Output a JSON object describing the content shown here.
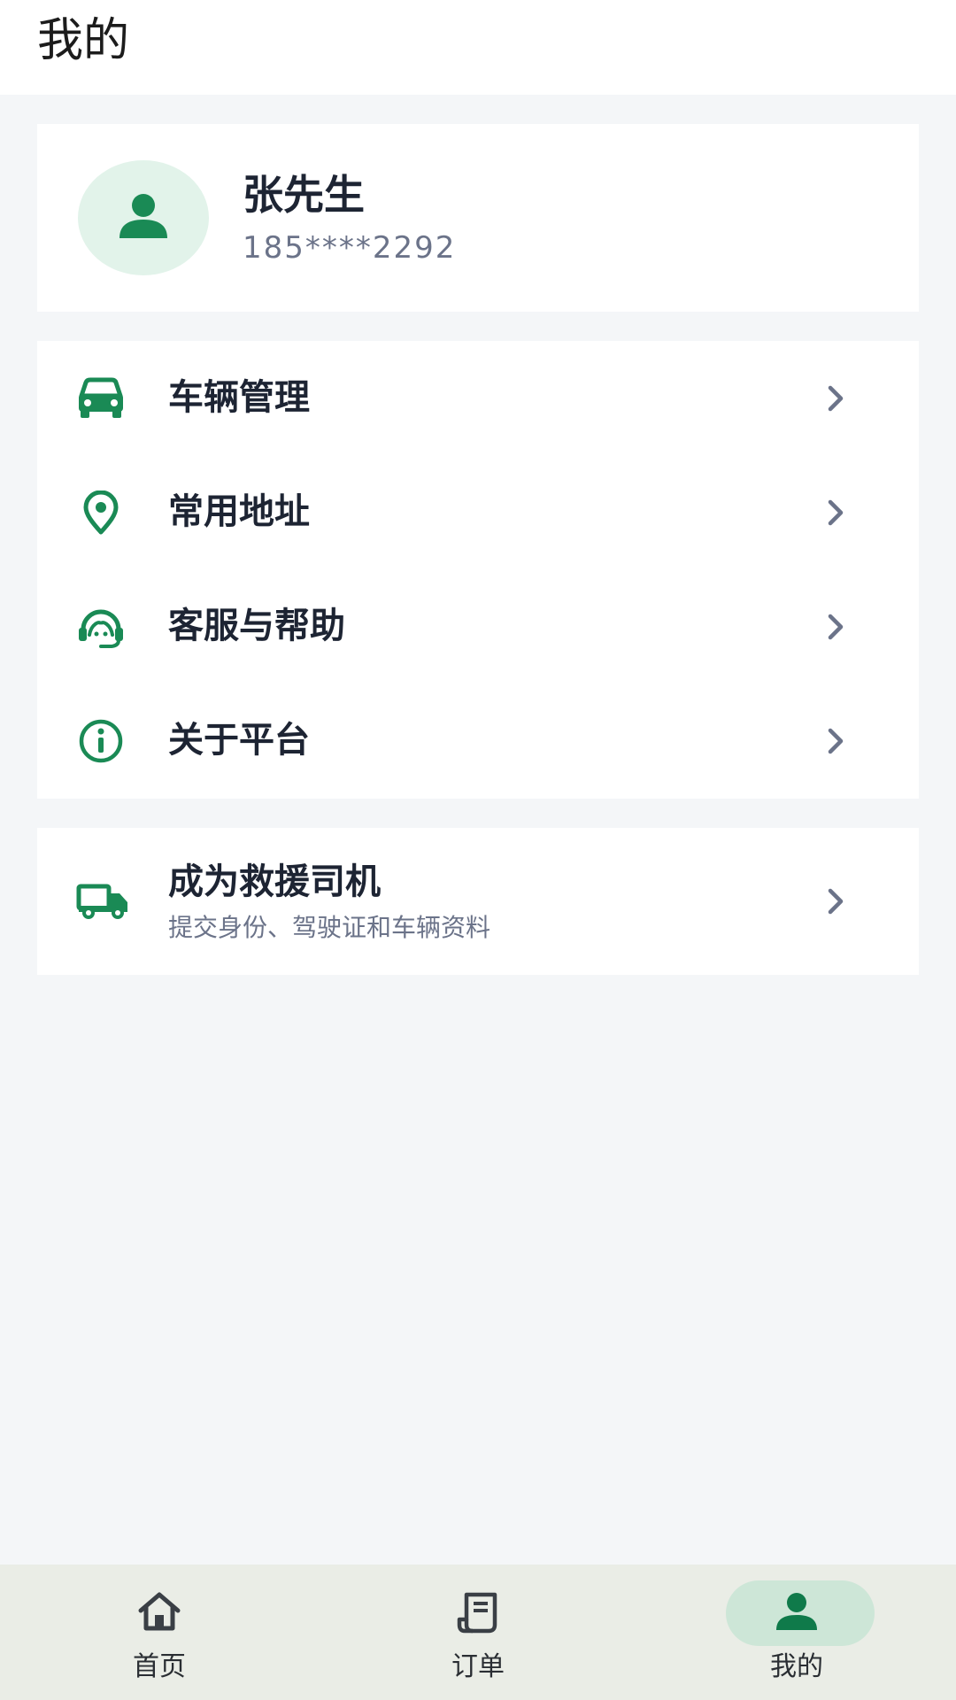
{
  "header": {
    "title": "我的"
  },
  "profile": {
    "name": "张先生",
    "phone": "185****2292"
  },
  "menu": [
    {
      "label": "车辆管理",
      "icon": "car-icon"
    },
    {
      "label": "常用地址",
      "icon": "location-pin-icon"
    },
    {
      "label": "客服与帮助",
      "icon": "headset-icon"
    },
    {
      "label": "关于平台",
      "icon": "info-icon"
    }
  ],
  "driver": {
    "title": "成为救援司机",
    "subtitle": "提交身份、驾驶证和车辆资料",
    "icon": "truck-icon"
  },
  "bottom_nav": [
    {
      "label": "首页",
      "icon": "home-icon",
      "active": false
    },
    {
      "label": "订单",
      "icon": "receipt-icon",
      "active": false
    },
    {
      "label": "我的",
      "icon": "person-icon",
      "active": true
    }
  ],
  "colors": {
    "accent": "#1a8a55",
    "background": "#f4f6f8",
    "text_primary": "#1d2433",
    "text_secondary": "#6b7389",
    "nav_background": "#eaede6",
    "nav_active_pill": "#cde6d7"
  }
}
